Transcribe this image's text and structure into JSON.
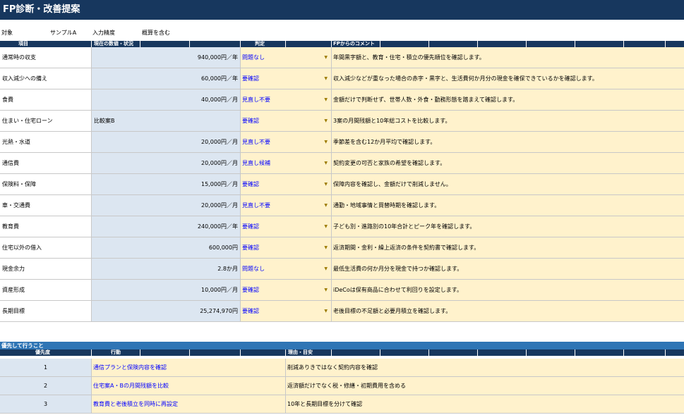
{
  "title": "FP診断・改善提案",
  "meta": {
    "target_label": "対象",
    "target_value": "サンプルA",
    "precision_label": "入力精度",
    "precision_value": "概算を含む"
  },
  "diag_headers": [
    "項目",
    "現在の数値・状況",
    "判定",
    "FPからのコメント"
  ],
  "diag_rows": [
    {
      "item": "通常時の収支",
      "text": "",
      "value": "940,000円／年",
      "judge": "問題なし",
      "comment": "年間黒字額と、教育・住宅・積立の優先順位を確認します。"
    },
    {
      "item": "収入減少への備え",
      "text": "",
      "value": "60,000円／年",
      "judge": "要確認",
      "comment": "収入減少などが重なった場合の赤字・黒字と、生活費何か月分の現金を確保できているかを確認します。"
    },
    {
      "item": "食費",
      "text": "",
      "value": "40,000円／月",
      "judge": "見直し不要",
      "comment": "金額だけで判断せず、世帯人数・外食・勤務形態を踏まえて確認します。"
    },
    {
      "item": "住まい・住宅ローン",
      "text": "比較案B",
      "value": "",
      "judge": "要確認",
      "comment": "3案の月間残額と10年総コストを比較します。"
    },
    {
      "item": "光熱・水道",
      "text": "",
      "value": "20,000円／月",
      "judge": "見直し不要",
      "comment": "季節差を含む12か月平均で確認します。"
    },
    {
      "item": "通信費",
      "text": "",
      "value": "20,000円／月",
      "judge": "見直し候補",
      "comment": "契約変更の可否と家族の希望を確認します。"
    },
    {
      "item": "保険料・保障",
      "text": "",
      "value": "15,000円／月",
      "judge": "要確認",
      "comment": "保障内容を確認し、金額だけで削減しません。"
    },
    {
      "item": "車・交通費",
      "text": "",
      "value": "20,000円／月",
      "judge": "見直し不要",
      "comment": "通勤・地域事情と買替時期を確認します。"
    },
    {
      "item": "教育費",
      "text": "",
      "value": "240,000円／年",
      "judge": "要確認",
      "comment": "子ども別・進路別の10年合計とピーク年を確認します。"
    },
    {
      "item": "住宅以外の借入",
      "text": "",
      "value": "600,000円",
      "judge": "要確認",
      "comment": "返済期間・金利・繰上返済の条件を契約書で確認します。"
    },
    {
      "item": "現金余力",
      "text": "",
      "value": "2.8か月",
      "judge": "問題なし",
      "comment": "最低生活費の何か月分を現金で持つか確認します。"
    },
    {
      "item": "資産形成",
      "text": "",
      "value": "10,000円／月",
      "judge": "要確認",
      "comment": "iDeCoは保有商品に合わせて利回りを設定します。"
    },
    {
      "item": "長期目標",
      "text": "",
      "value": "25,274,970円",
      "judge": "要確認",
      "comment": "老後目標の不足額と必要月積立を確認します。"
    }
  ],
  "priority": {
    "section_title": "優先して行うこと",
    "headers": [
      "優先度",
      "行動",
      "理由・目安"
    ],
    "rows": [
      {
        "rank": "1",
        "action": "通信プランと保険内容を確認",
        "reason": "削減ありきではなく契約内容を確認"
      },
      {
        "rank": "2",
        "action": "住宅案A・Bの月間残額を比較",
        "reason": "返済額だけでなく税・修繕・初期費用を含める"
      },
      {
        "rank": "3",
        "action": "教育費と老後積立を同時に再設定",
        "reason": "10年と長期目標を分けて確認"
      }
    ]
  },
  "colors": {
    "header_bg": "#17375e",
    "section_bg": "#2f75b5",
    "input_blue": "#dce6f1",
    "input_yellow": "#fff2cc",
    "judge_text": "#0000ff"
  },
  "icons": {
    "dropdown": "dropdown-arrow-icon"
  }
}
